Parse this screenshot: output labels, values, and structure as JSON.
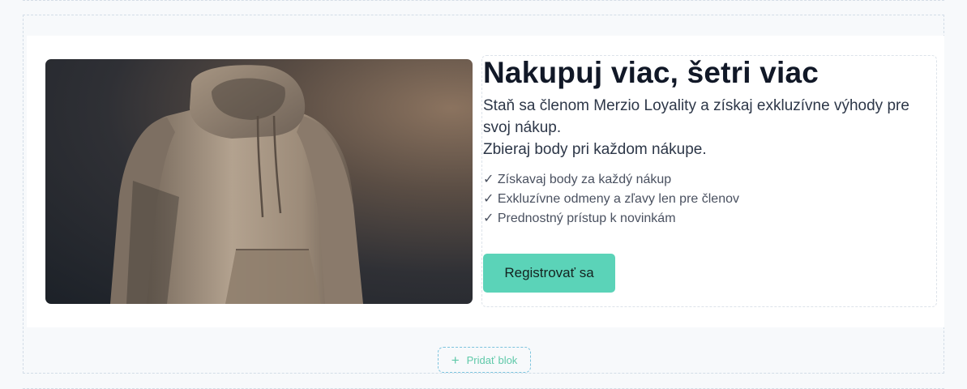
{
  "hero": {
    "headline": "Nakupuj viac, šetri viac",
    "description_lines": [
      "Staň sa členom Merzio Loyality a získaj exkluzívne výhody pre svoj nákup.",
      "Zbieraj body pri každom nákupe."
    ],
    "benefits": [
      "✓ Získavaj body za každý nákup",
      "✓ Exkluzívne odmeny a zľavy len pre členov",
      "✓ Prednostný prístup k novinkám"
    ],
    "cta_label": "Registrovať sa",
    "image_icon": "hoodie-product-photo",
    "accent_color": "#5bd3b8"
  },
  "editor": {
    "add_block_label": "Pridať blok",
    "add_block_icon": "plus-icon"
  }
}
